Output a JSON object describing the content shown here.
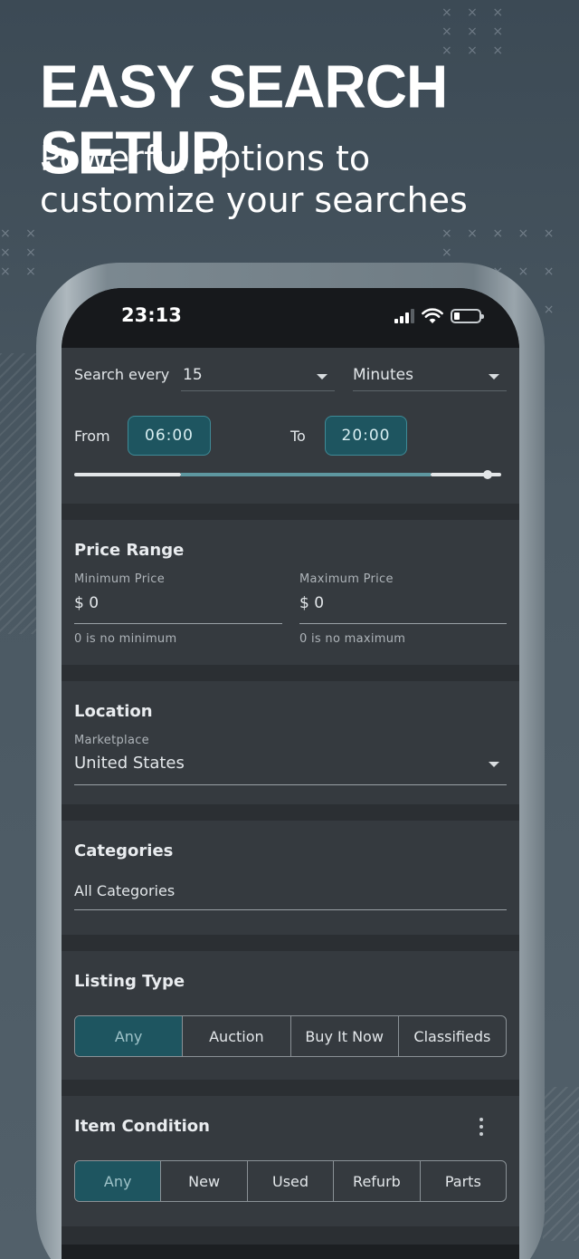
{
  "promo": {
    "headline": "EASY SEARCH SETUP",
    "subhead_line1": "Powerful options to",
    "subhead_line2": "customize your searches"
  },
  "status_bar": {
    "time": "23:13"
  },
  "schedule": {
    "search_every_label": "Search every",
    "interval_value": "15",
    "unit_value": "Minutes",
    "from_label": "From",
    "from_value": "06:00",
    "to_label": "To",
    "to_value": "20:00"
  },
  "price_range": {
    "title": "Price Range",
    "min_label": "Minimum Price",
    "min_value": "$ 0",
    "min_helper": "0 is no minimum",
    "max_label": "Maximum Price",
    "max_value": "$ 0",
    "max_helper": "0 is no maximum"
  },
  "location": {
    "title": "Location",
    "marketplace_label": "Marketplace",
    "marketplace_value": "United States"
  },
  "categories": {
    "title": "Categories",
    "value": "All Categories"
  },
  "listing_type": {
    "title": "Listing Type",
    "options": [
      "Any",
      "Auction",
      "Buy It Now",
      "Classifieds"
    ],
    "selected": "Any"
  },
  "item_condition": {
    "title": "Item Condition",
    "options": [
      "Any",
      "New",
      "Used",
      "Refurb",
      "Parts"
    ],
    "selected": "Any"
  },
  "colors": {
    "accent": "#1e5560",
    "accent_border": "#3f8a96",
    "slider_track": "#5e97a0"
  }
}
